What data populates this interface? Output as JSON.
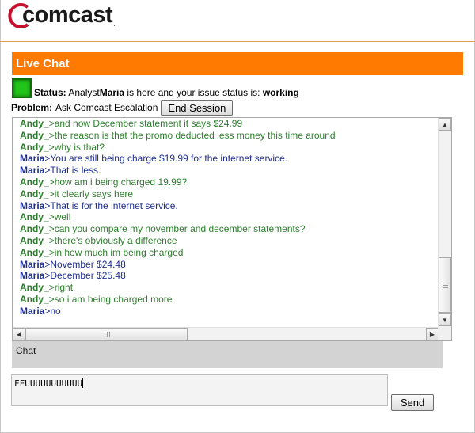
{
  "brand": {
    "logo_text": "comcast",
    "logo_dot": ".",
    "accent": "#ff7a00"
  },
  "header": {
    "title": "Live Chat"
  },
  "status": {
    "label": "Status:",
    "pre": "Analyst",
    "analyst": "Maria",
    "mid": "is here and your issue status is:",
    "state": "working",
    "light_color": "#22c41a"
  },
  "problem": {
    "label": "Problem:",
    "value": "Ask Comcast Escalation",
    "end_button": "End Session"
  },
  "transcript": {
    "andy_color": "#2f7d2f",
    "maria_color": "#1f2f8f",
    "lines": [
      {
        "who": "Andy_",
        "text": ">and now December statement it says $24.99"
      },
      {
        "who": "Andy_",
        "text": ">the reason is that the promo deducted less money this time around"
      },
      {
        "who": "Andy_",
        "text": ">why is that?"
      },
      {
        "who": "Maria",
        "text": ">You are still being charge $19.99 for the internet service."
      },
      {
        "who": "Maria",
        "text": ">That is less."
      },
      {
        "who": "Andy_",
        "text": ">how am i being charged 19.99?"
      },
      {
        "who": "Andy_",
        "text": ">it clearly says here"
      },
      {
        "who": "Maria",
        "text": ">That is for the internet service."
      },
      {
        "who": "Andy_",
        "text": ">well"
      },
      {
        "who": "Andy_",
        "text": ">can you compare my november and december statements?"
      },
      {
        "who": "Andy_",
        "text": ">there's obviously a difference"
      },
      {
        "who": "Andy_",
        "text": ">in how much im being charged"
      },
      {
        "who": "Maria",
        "text": ">November $24.48"
      },
      {
        "who": "Maria",
        "text": ">December $25.48"
      },
      {
        "who": "Andy_",
        "text": ">right"
      },
      {
        "who": "Andy_",
        "text": ">so i am being charged more"
      },
      {
        "who": "Maria",
        "text": ">no"
      }
    ]
  },
  "chat_label": "Chat",
  "input": {
    "value": "FFUUUUUUUUUUU"
  },
  "send_button": "Send"
}
